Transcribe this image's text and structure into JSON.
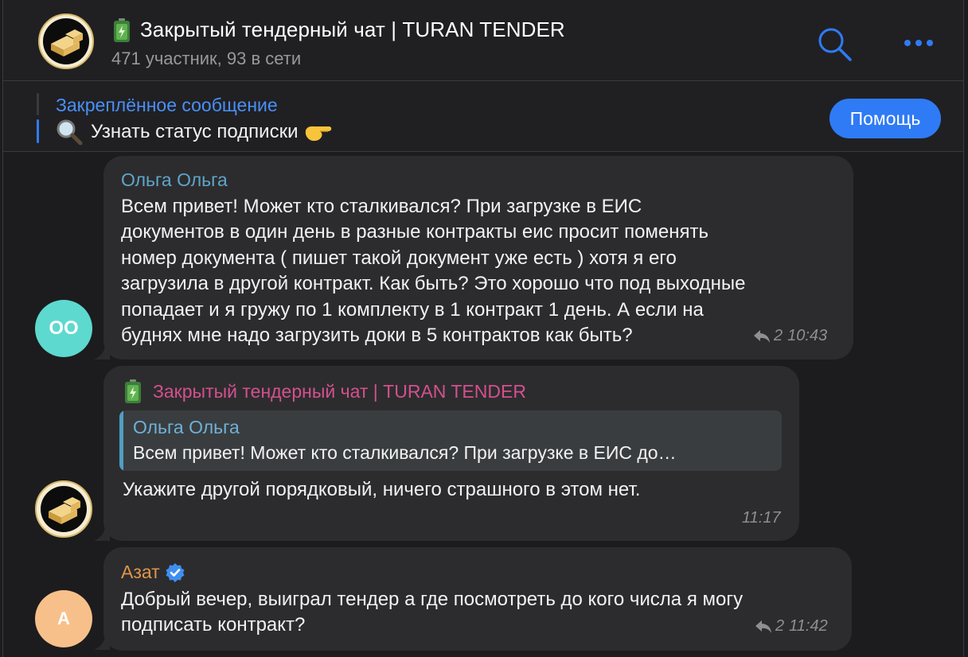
{
  "header": {
    "title": "Закрытый тендерный чат | TURAN TENDER",
    "subtitle": "471 участник, 93 в сети",
    "avatar_icon": "brick-logo-icon",
    "title_icon": "battery-icon"
  },
  "pinned": {
    "title": "Закреплённое сообщение",
    "text": "Узнать статус подписки",
    "help_label": "Помощь"
  },
  "messages": [
    {
      "sender": "Ольга Ольга",
      "avatar_initials": "OO",
      "avatar_color": "#5ed9cf",
      "lines": [
        "Всем привет! Может кто сталкивался? При загрузке в ЕИС",
        "документов в один день в разные контракты еис просит поменять",
        "номер документа (  пишет такой документ уже есть ) хотя я его",
        "загрузила в другой контракт. Как быть? Это хорошо что под выходные",
        "попадает и я гружу по 1 комплекту в 1 контракт 1 день. А если на",
        "буднях мне надо загрузить доки в 5 контрактов как быть?"
      ],
      "replies": "2",
      "time": "10:43"
    },
    {
      "sender": "Закрытый тендерный чат | TURAN TENDER",
      "quote_name": "Ольга Ольга",
      "quote_text": "Всем привет! Может кто сталкивался? При загрузке в ЕИС до…",
      "text": "Укажите другой порядковый, ничего страшного в этом нет.",
      "time": "11:17"
    },
    {
      "sender": "Азат",
      "avatar_initials": "A",
      "avatar_color": "#f7c08a",
      "lines": [
        "Добрый вечер, выиграл тендер а где посмотреть до кого числа я могу",
        "подписать контракт?"
      ],
      "replies": "2",
      "time": "11:42"
    }
  ],
  "colors": {
    "accent": "#2f7bf5",
    "sender_olga": "#5fa5c9",
    "sender_channel": "#d4508e",
    "sender_azat": "#e0964a"
  }
}
